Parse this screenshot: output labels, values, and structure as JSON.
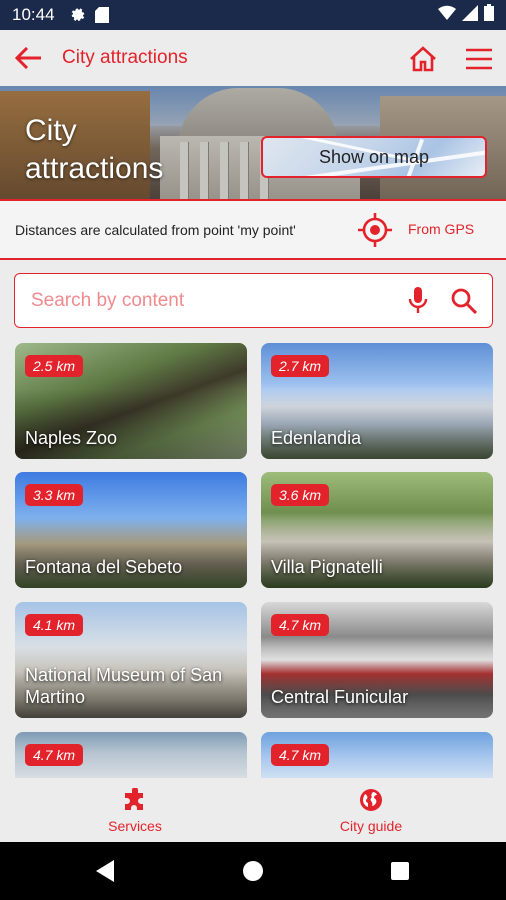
{
  "status_bar": {
    "time": "10:44",
    "icons": [
      "gear-icon",
      "sd-card-icon",
      "wifi-icon",
      "signal-icon",
      "battery-icon"
    ],
    "bg_color": "#1b2a4a"
  },
  "app_bar": {
    "title": "City attractions",
    "accent_color": "#e3232b",
    "icons": [
      "back-arrow-icon",
      "home-icon",
      "hamburger-menu-icon"
    ]
  },
  "banner": {
    "title": "City attractions",
    "map_button_label": "Show on map"
  },
  "distance": {
    "text": "Distances are calculated from point 'my point'",
    "gps_label": "From GPS"
  },
  "search": {
    "placeholder": "Search by content"
  },
  "attractions": [
    {
      "name": "Naples Zoo",
      "distance": "2.5 km"
    },
    {
      "name": "Edenlandia",
      "distance": "2.7 km"
    },
    {
      "name": "Fontana del Sebeto",
      "distance": "3.3 km"
    },
    {
      "name": "Villa Pignatelli",
      "distance": "3.6 km"
    },
    {
      "name": "National Museum of San Martino",
      "distance": "4.1 km"
    },
    {
      "name": "Central Funicular",
      "distance": "4.7 km"
    },
    {
      "name": "",
      "distance": "4.7 km"
    },
    {
      "name": "",
      "distance": "4.7 km"
    }
  ],
  "bottom_nav": {
    "items": [
      {
        "label": "Services",
        "icon": "puzzle-icon"
      },
      {
        "label": "City guide",
        "icon": "globe-icon"
      }
    ]
  }
}
